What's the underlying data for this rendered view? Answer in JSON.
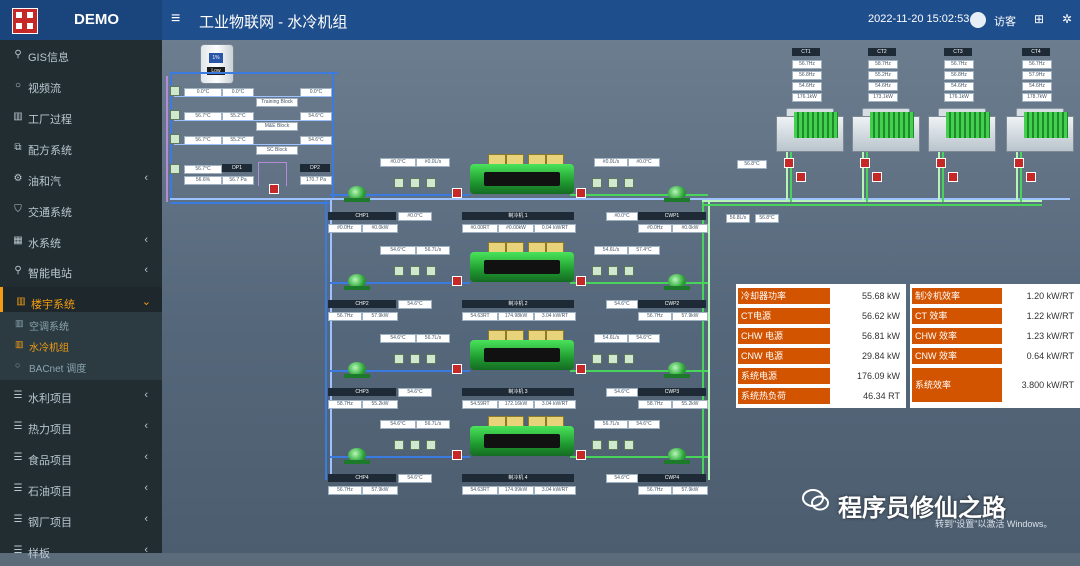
{
  "header": {
    "brand": "DEMO",
    "menu_icon": "hamburger-icon",
    "breadcrumb": "工业物联网 - 水冷机组",
    "datetime": "2022-11-20 15:02:53",
    "user": "访客"
  },
  "sidebar": {
    "items": [
      {
        "label": "GIS信息",
        "icon": "map-pin-icon",
        "has_children": false
      },
      {
        "label": "视频流",
        "icon": "circle-icon",
        "has_children": false
      },
      {
        "label": "工厂过程",
        "icon": "chart-icon",
        "has_children": false
      },
      {
        "label": "配方系统",
        "icon": "cubes-icon",
        "has_children": false
      },
      {
        "label": "油和汽",
        "icon": "cogs-icon",
        "has_children": true
      },
      {
        "label": "交通系统",
        "icon": "shield-icon",
        "has_children": false
      },
      {
        "label": "水系统",
        "icon": "map-icon",
        "has_children": true
      },
      {
        "label": "智能电站",
        "icon": "map-pin-icon",
        "has_children": true
      },
      {
        "label": "楼宇系统",
        "icon": "chart-icon",
        "has_children": true,
        "active": true
      },
      {
        "label": "水利项目",
        "icon": "sliders-icon",
        "has_children": true
      },
      {
        "label": "热力项目",
        "icon": "sliders-icon",
        "has_children": true
      },
      {
        "label": "食品项目",
        "icon": "sliders-icon",
        "has_children": true
      },
      {
        "label": "石油项目",
        "icon": "sliders-icon",
        "has_children": true
      },
      {
        "label": "钢厂项目",
        "icon": "sliders-icon",
        "has_children": true
      },
      {
        "label": "样板",
        "icon": "sliders-icon",
        "has_children": true
      }
    ],
    "submenu": [
      {
        "label": "空调系统",
        "active": false
      },
      {
        "label": "水冷机组",
        "active": true
      },
      {
        "label": "BACnet 调度",
        "active": false
      }
    ]
  },
  "left_panel": {
    "tank": {
      "level": "1%",
      "status": "Low"
    },
    "rows": [
      {
        "v1": "0.0°C",
        "v2": "0.0°C",
        "block": "Training Block",
        "v3": "0.0°C"
      },
      {
        "v1": "56.7°C",
        "v2": "55.2°C",
        "block": "M&E Block",
        "v3": "54.6°C"
      },
      {
        "v1": "56.7°C",
        "v2": "55.2°C",
        "block": "SC Block",
        "v3": "54.6°C"
      }
    ],
    "dp1": {
      "label": "DP1",
      "v1": "56.7°C",
      "v2": "56.6%",
      "v3": "56.7 Pa"
    },
    "dp2": {
      "label": "DP2",
      "v": "170.7 Pa"
    }
  },
  "chillers": [
    {
      "name": "制冷机 1",
      "chp": "CHP1",
      "cwp": "CWP1",
      "chp_v": "#0.0°C",
      "cwp_v": "#0.0°C",
      "v1": "#0.00RT",
      "v2": "#0.00kW",
      "v3": "0.04 kW/RT",
      "chp_b1": "#0.0Hz",
      "chp_b2": "#0.0kW",
      "cwp_b1": "#0.0Hz",
      "cwp_b2": "#0.0kW",
      "top_l": [
        "#0.0°C",
        "#0.0L/s"
      ],
      "top_r": [
        "#0.0L/s",
        "#0.0°C"
      ]
    },
    {
      "name": "制冷机 2",
      "chp": "CHP2",
      "cwp": "CWP2",
      "chp_v": "54.6°C",
      "cwp_v": "54.6°C",
      "v1": "54.63RT",
      "v2": "174.98kW",
      "v3": "3.04 kW/RT",
      "chp_b1": "56.7Hz",
      "chp_b2": "57.9kW",
      "cwp_b1": "56.7Hz",
      "cwp_b2": "57.9kW",
      "top_l": [
        "54.6°C",
        "56.7L/s"
      ],
      "top_r": [
        "54.6L/s",
        "57.4°C"
      ]
    },
    {
      "name": "制冷机 3",
      "chp": "CHP3",
      "cwp": "CWP3",
      "chp_v": "54.6°C",
      "cwp_v": "54.6°C",
      "v1": "54.59RT",
      "v2": "172.16kW",
      "v3": "3.04 kW/RT",
      "chp_b1": "58.7Hz",
      "chp_b2": "55.2kW",
      "cwp_b1": "58.7Hz",
      "cwp_b2": "55.2kW",
      "top_l": [
        "54.6°C",
        "56.7L/s"
      ],
      "top_r": [
        "54.6L/s",
        "54.6°C"
      ]
    },
    {
      "name": "制冷机 4",
      "chp": "CHP4",
      "cwp": "CWP4",
      "chp_v": "54.6°C",
      "cwp_v": "54.6°C",
      "v1": "54.63RT",
      "v2": "174.99kW",
      "v3": "3.04 kW/RT",
      "chp_b1": "56.7Hz",
      "chp_b2": "57.9kW",
      "cwp_b1": "56.7Hz",
      "cwp_b2": "57.9kW",
      "top_l": [
        "54.6°C",
        "56.7L/s"
      ],
      "top_r": [
        "56.7L/s",
        "54.6°C"
      ]
    }
  ],
  "header_line": {
    "v_mid": "56.8°C",
    "v_left": "56.8L/s",
    "v_right": "56.8°C"
  },
  "towers": [
    {
      "name": "CT1",
      "rows": [
        "56.7Hz",
        "56.8Hz",
        "54.6Hz",
        "176.1kW"
      ]
    },
    {
      "name": "CT2",
      "rows": [
        "58.7Hz",
        "55.2Hz",
        "54.6Hz",
        "173.1kW"
      ]
    },
    {
      "name": "CT3",
      "rows": [
        "56.7Hz",
        "56.8Hz",
        "54.6Hz",
        "176.1kW"
      ]
    },
    {
      "name": "CT4",
      "rows": [
        "56.7Hz",
        "57.9Hz",
        "54.6Hz",
        "178.7kW"
      ]
    }
  ],
  "kpis_left": [
    {
      "label": "冷却器功率",
      "value": "55.68 kW"
    },
    {
      "label": "CT电源",
      "value": "56.62 kW"
    },
    {
      "label": "CHW 电源",
      "value": "56.81 kW"
    },
    {
      "label": "CNW 电源",
      "value": "29.84 kW"
    },
    {
      "label": "系统电源",
      "value": "176.09 kW"
    },
    {
      "label": "系统热负荷",
      "value": "46.34 RT"
    }
  ],
  "kpis_right": [
    {
      "label": "制冷机效率",
      "value": "1.20 kW/RT"
    },
    {
      "label": "CT 效率",
      "value": "1.22 kW/RT"
    },
    {
      "label": "CHW 效率",
      "value": "1.23 kW/RT"
    },
    {
      "label": "CNW 效率",
      "value": "0.64 kW/RT"
    },
    {
      "label": "系统效率",
      "value": "3.800 kW/RT"
    }
  ],
  "watermark": {
    "text": "程序员修仙之路",
    "sub": "转到\"设置\"以激活 Windows。"
  }
}
